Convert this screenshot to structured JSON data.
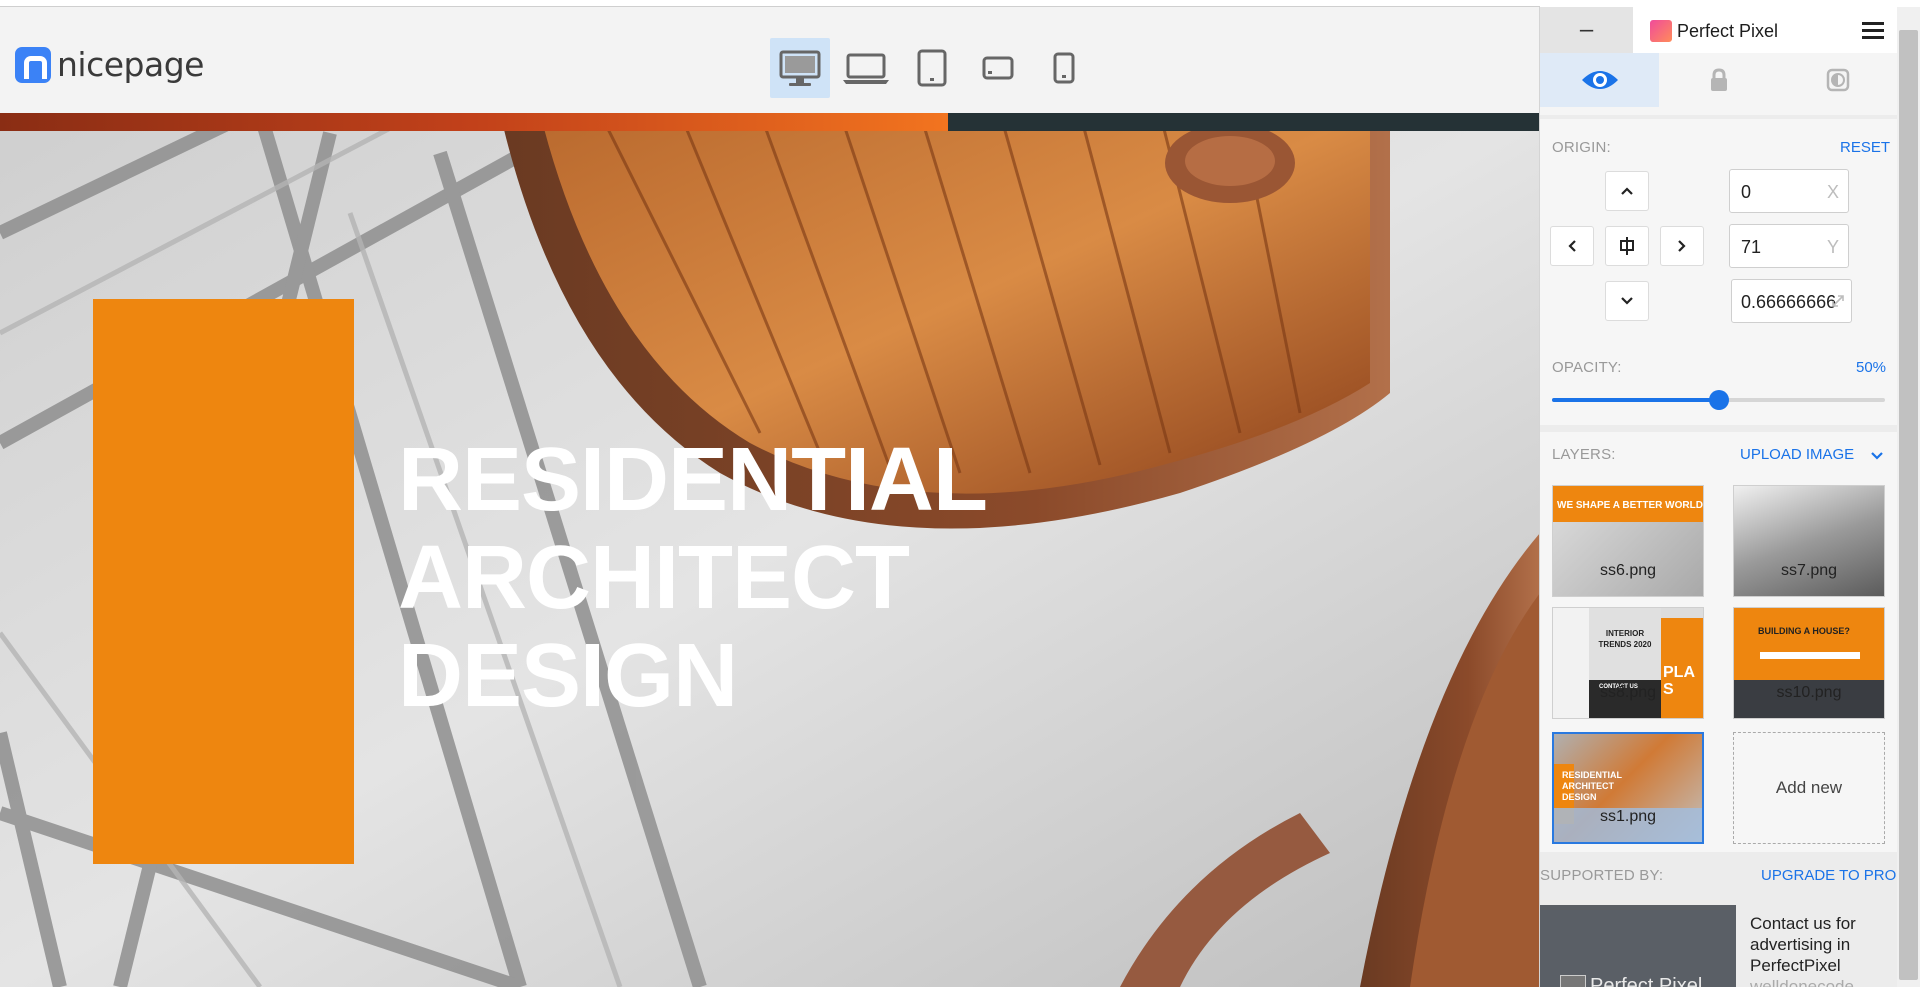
{
  "brand": {
    "name": "nicepage"
  },
  "device_bar": {
    "devices": [
      {
        "name": "desktop-icon",
        "active": true
      },
      {
        "name": "laptop-icon",
        "active": false
      },
      {
        "name": "tablet-icon",
        "active": false
      },
      {
        "name": "tablet-landscape-icon",
        "active": false
      },
      {
        "name": "phone-icon",
        "active": false
      }
    ]
  },
  "hero": {
    "title_lines": [
      "RESIDENTIAL",
      "ARCHITECT",
      "DESIGN"
    ],
    "accent_color": "#ee860f"
  },
  "perfect_pixel": {
    "minimize_label": "–",
    "title": "Perfect Pixel",
    "tabs": [
      {
        "name": "eye-icon",
        "active": true
      },
      {
        "name": "lock-icon",
        "active": false
      },
      {
        "name": "invert-icon",
        "active": false
      }
    ],
    "origin": {
      "label": "ORIGIN:",
      "reset_label": "RESET",
      "x_value": "0",
      "x_axis": "X",
      "y_value": "71",
      "y_axis": "Y",
      "scale_value": "0.66666666"
    },
    "opacity": {
      "label": "OPACITY:",
      "value_label": "50%",
      "value": 0.5
    },
    "layers": {
      "label": "LAYERS:",
      "upload_label": "UPLOAD IMAGE",
      "items": [
        {
          "file": "ss6.png",
          "caption": "WE SHAPE A BETTER WORLD",
          "active": false
        },
        {
          "file": "ss7.png",
          "caption": "",
          "active": false
        },
        {
          "file": "ss8.png",
          "caption": "INTERIOR TRENDS 2020",
          "caption2": "PLA S",
          "caption3": "CONTACT US",
          "active": false
        },
        {
          "file": "ss10.png",
          "caption": "BUILDING A HOUSE?",
          "active": false
        },
        {
          "file": "ss1.png",
          "caption": "RESIDENTIAL ARCHITECT DESIGN",
          "active": true
        }
      ],
      "add_new_label": "Add new"
    },
    "support": {
      "label": "SUPPORTED BY:",
      "upgrade_label": "UPGRADE TO PRO",
      "ad_image_text": "Perfect Pixel",
      "ad_text": "Contact us for advertising in PerfectPixel",
      "ad_text_cut": "welldonecode"
    }
  },
  "colors": {
    "accent_blue": "#1a73e8",
    "hero_orange": "#ee860f",
    "stripe_dark": "#253236"
  }
}
